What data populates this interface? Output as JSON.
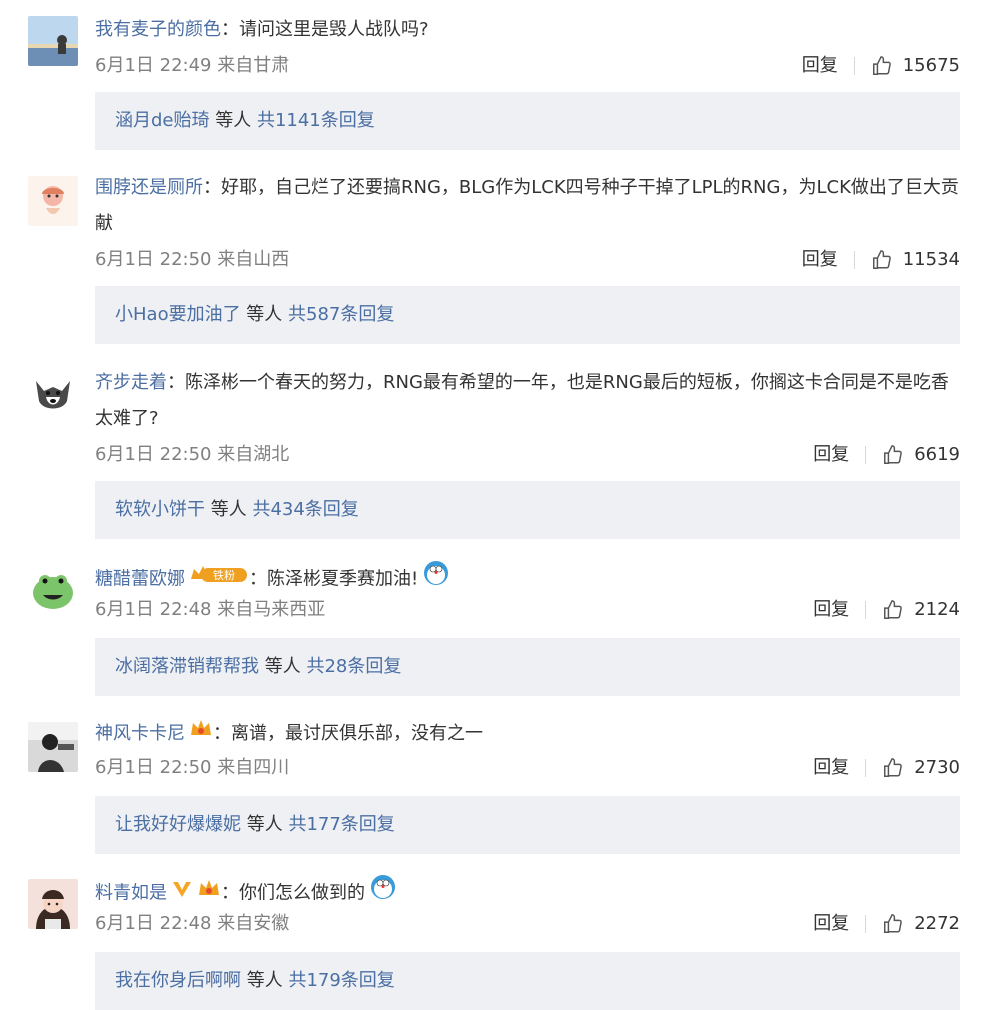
{
  "ui": {
    "reply_label": "回复",
    "others_label": " 等人 "
  },
  "comments": [
    {
      "user": "我有麦子的颜色",
      "text": "请问这里是毁人战队吗?",
      "time": "6月1日 22:49",
      "location": "来自甘肃",
      "likes": "15675",
      "sub_user": "涵月de贻琦",
      "sub_total": "共1141条回复",
      "badges": [],
      "emoji": ""
    },
    {
      "user": "围脖还是厕所",
      "text": "好耶，自己烂了还要搞RNG，BLG作为LCK四号种子干掉了LPL的RNG，为LCK做出了巨大贡献",
      "time": "6月1日 22:50",
      "location": "来自山西",
      "likes": "11534",
      "sub_user": "小Hao要加油了",
      "sub_total": "共587条回复",
      "badges": [],
      "emoji": ""
    },
    {
      "user": "齐步走着",
      "text": "陈泽彬一个春天的努力，RNG最有希望的一年，也是RNG最后的短板，你搁这卡合同是不是吃香太难了?",
      "time": "6月1日 22:50",
      "location": "来自湖北",
      "likes": "6619",
      "sub_user": "软软小饼干",
      "sub_total": "共434条回复",
      "badges": [],
      "emoji": ""
    },
    {
      "user": "糖醋蕾欧娜",
      "text": "陈泽彬夏季赛加油!",
      "time": "6月1日 22:48",
      "location": "来自马来西亚",
      "likes": "2124",
      "sub_user": "冰阔落滞销帮帮我",
      "sub_total": "共28条回复",
      "badges": [
        "fan-crown-badge"
      ],
      "badge_text": "铁粉",
      "emoji": "doraemon-emoji"
    },
    {
      "user": "神风卡卡尼",
      "text": "离谱，最讨厌俱乐部，没有之一",
      "time": "6月1日 22:50",
      "location": "来自四川",
      "likes": "2730",
      "sub_user": "让我好好爆爆妮",
      "sub_total": "共177条回复",
      "badges": [
        "crown-badge"
      ],
      "emoji": ""
    },
    {
      "user": "料青如是",
      "text": "你们怎么做到的",
      "time": "6月1日 22:48",
      "location": "来自安徽",
      "likes": "2272",
      "sub_user": "我在你身后啊啊",
      "sub_total": "共179条回复",
      "badges": [
        "verified-v-badge",
        "crown-badge"
      ],
      "emoji": "doraemon-emoji"
    }
  ],
  "colors": {
    "username": "#4b6ea3",
    "text": "#333333",
    "meta": "#808080",
    "subbox": "#eef0f3",
    "badge_orange": "#f0a020",
    "verified": "#f5a623"
  }
}
